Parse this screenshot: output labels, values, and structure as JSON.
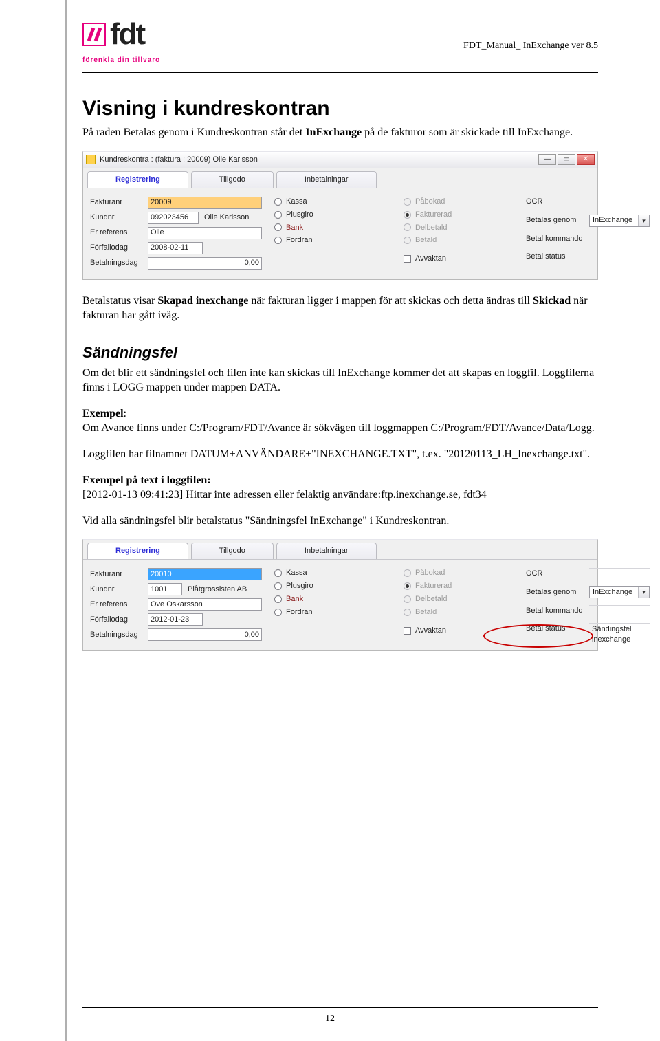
{
  "header": {
    "logo_word": "fdt",
    "logo_tagline": "förenkla din tillvaro",
    "doc_ref": "FDT_Manual_ InExchange ver 8.5"
  },
  "h1": "Visning i kundreskontran",
  "p1_before": "På raden Betalas genom i Kundreskontran står det ",
  "p1_bold": "InExchange",
  "p1_after": " på de fakturor som är skickade till InExchange.",
  "sshot1": {
    "title": "Kundreskontra : (faktura : 20009) Olle Karlsson",
    "tabs": [
      "Registrering",
      "Tillgodo",
      "Inbetalningar"
    ],
    "left_labels": [
      "Fakturanr",
      "Kundnr",
      "Er referens",
      "Förfallodag",
      "Betalningsdag"
    ],
    "left_values": {
      "fakturanr": "20009",
      "kundnr": "092023456",
      "kundnamn": "Olle Karlsson",
      "er_referens": "Olle",
      "forfallodag": "2008-02-11",
      "betalningsdag": "0,00"
    },
    "col2_opts": [
      "Kassa",
      "Plusgiro",
      "Bank",
      "Fordran"
    ],
    "col3_opts": [
      "Påbokad",
      "Fakturerad",
      "Delbetald",
      "Betald"
    ],
    "avvaktan": "Avvaktan",
    "col4_labels": [
      "OCR",
      "Betalas genom",
      "Betal kommando",
      "Betal status"
    ],
    "betalas_genom": "InExchange"
  },
  "p2_a": "Betalstatus visar ",
  "p2_b": "Skapad inexchange",
  "p2_c": " när fakturan ligger i mappen för att skickas och detta ändras till ",
  "p2_d": "Skickad",
  "p2_e": " när fakturan har gått iväg.",
  "h2": "Sändningsfel",
  "p3": "Om det blir ett sändningsfel och filen inte kan skickas till InExchange kommer det att skapas en loggfil. Loggfilerna finns i LOGG mappen under mappen DATA.",
  "p4_bold": "Exempel",
  "p4_rest": ":\nOm Avance finns under C:/Program/FDT/Avance är sökvägen till loggmappen C:/Program/FDT/Avance/Data/Logg.",
  "p5": "Loggfilen har filnamnet DATUM+ANVÄNDARE+\"INEXCHANGE.TXT\", t.ex. \"20120113_LH_Inexchange.txt\".",
  "p6_bold": "Exempel på text i loggfilen:",
  "p6_rest": "[2012-01-13 09:41:23] Hittar inte adressen eller felaktig användare:ftp.inexchange.se, fdt34",
  "p7": "Vid alla sändningsfel blir betalstatus \"Sändningsfel InExchange\" i Kundreskontran.",
  "sshot2": {
    "tabs": [
      "Registrering",
      "Tillgodo",
      "Inbetalningar"
    ],
    "left_labels": [
      "Fakturanr",
      "Kundnr",
      "Er referens",
      "Förfallodag",
      "Betalningsdag"
    ],
    "left_values": {
      "fakturanr": "20010",
      "kundnr": "1001",
      "kundnamn": "Plåtgrossisten AB",
      "er_referens": "Ove Oskarsson",
      "forfallodag": "2012-01-23",
      "betalningsdag": "0,00"
    },
    "col2_opts": [
      "Kassa",
      "Plusgiro",
      "Bank",
      "Fordran"
    ],
    "col3_opts": [
      "Påbokad",
      "Fakturerad",
      "Delbetald",
      "Betald"
    ],
    "avvaktan": "Avvaktan",
    "col4_labels": [
      "OCR",
      "Betalas genom",
      "Betal kommando",
      "Betal status"
    ],
    "betalas_genom": "InExchange",
    "betal_status": "Sändingsfel inexchange"
  },
  "page_number": "12"
}
